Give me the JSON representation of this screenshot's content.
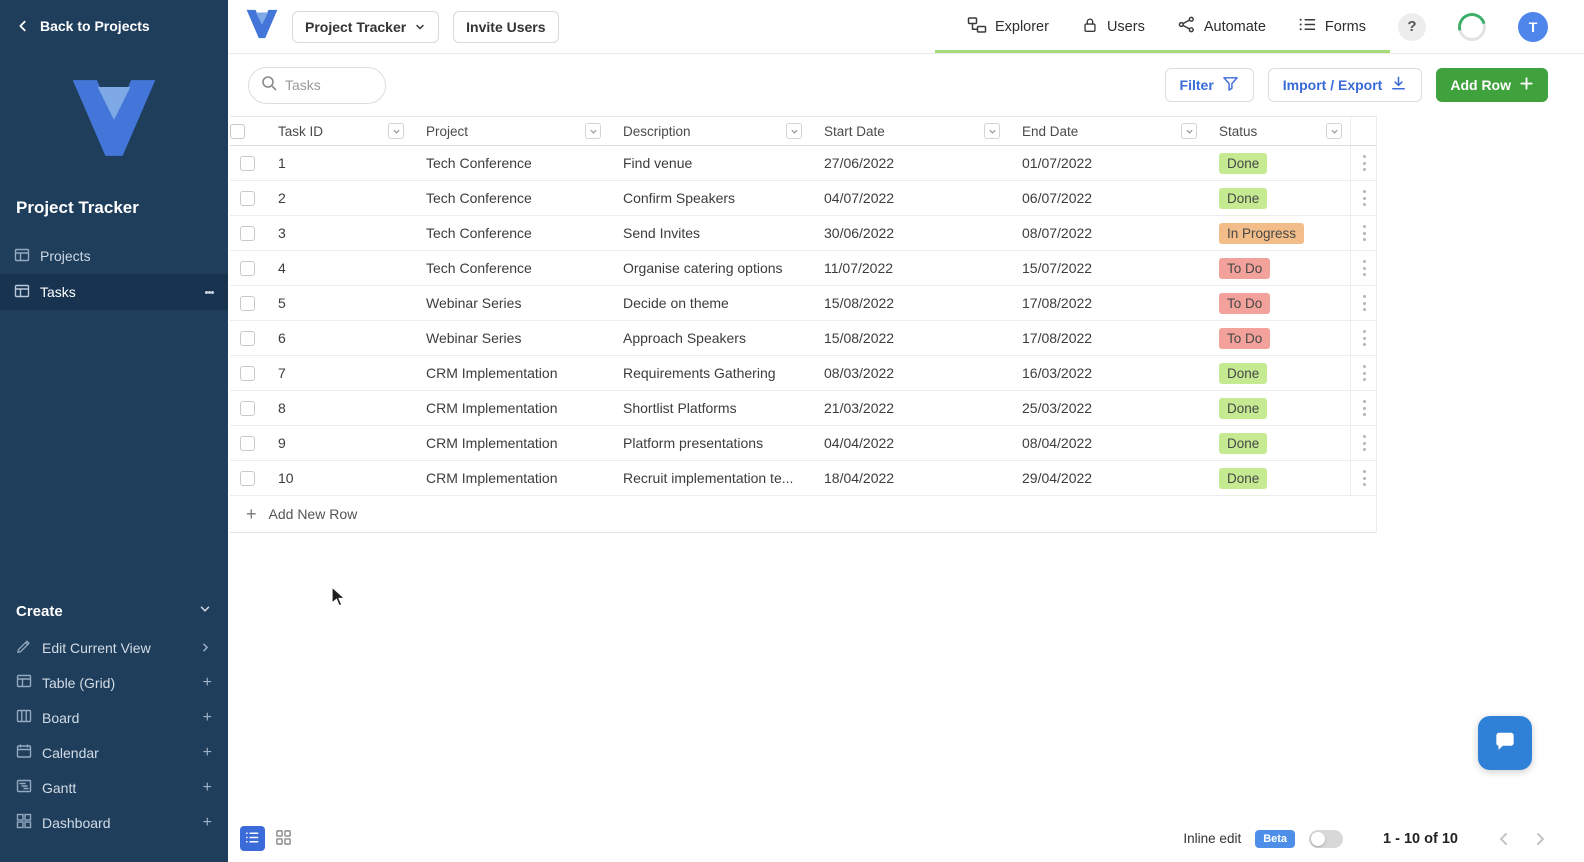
{
  "colors": {
    "sidebar_bg": "#1f3e5c",
    "sidebar_selected_bg": "#173350",
    "accent_blue": "#3a6bd8",
    "add_row_green": "#3fa23d",
    "status_done_bg": "#c6ea91",
    "status_in_progress_bg": "#f2bd88",
    "status_todo_bg": "#f2a29a",
    "status_text": "#474747",
    "beta_badge_bg": "#4d8fe8",
    "nav_underline_green": "#a6d977",
    "avatar_bg": "#4f86ec",
    "chat_button_bg": "#2f80d7",
    "logo_blue": "#4376d8",
    "logo_light_blue": "#7fa9e6"
  },
  "sidebar": {
    "back_label": "Back to Projects",
    "workspace_title": "Project Tracker",
    "items": [
      {
        "label": "Projects",
        "selected": false
      },
      {
        "label": "Tasks",
        "selected": true
      }
    ],
    "create_label": "Create",
    "create_items": [
      {
        "label": "Edit Current View"
      },
      {
        "label": "Table (Grid)"
      },
      {
        "label": "Board"
      },
      {
        "label": "Calendar"
      },
      {
        "label": "Gantt"
      },
      {
        "label": "Dashboard"
      }
    ]
  },
  "header": {
    "workspace_selector_label": "Project Tracker",
    "invite_button_label": "Invite Users",
    "nav_items": [
      {
        "label": "Explorer"
      },
      {
        "label": "Users"
      },
      {
        "label": "Automate"
      },
      {
        "label": "Forms"
      }
    ],
    "help_label": "?",
    "avatar_initial": "T"
  },
  "toolbar": {
    "search_placeholder": "Tasks",
    "filter_label": "Filter",
    "import_export_label": "Import / Export",
    "add_row_label": "Add Row"
  },
  "table": {
    "columns": [
      "Task ID",
      "Project",
      "Description",
      "Start Date",
      "End Date",
      "Status"
    ],
    "rows": [
      {
        "task_id": "1",
        "project": "Tech Conference",
        "description": "Find venue",
        "start_date": "27/06/2022",
        "end_date": "01/07/2022",
        "status": "Done"
      },
      {
        "task_id": "2",
        "project": "Tech Conference",
        "description": "Confirm Speakers",
        "start_date": "04/07/2022",
        "end_date": "06/07/2022",
        "status": "Done"
      },
      {
        "task_id": "3",
        "project": "Tech Conference",
        "description": "Send Invites",
        "start_date": "30/06/2022",
        "end_date": "08/07/2022",
        "status": "In Progress"
      },
      {
        "task_id": "4",
        "project": "Tech Conference",
        "description": "Organise catering options",
        "start_date": "11/07/2022",
        "end_date": "15/07/2022",
        "status": "To Do"
      },
      {
        "task_id": "5",
        "project": "Webinar Series",
        "description": "Decide on theme",
        "start_date": "15/08/2022",
        "end_date": "17/08/2022",
        "status": "To Do"
      },
      {
        "task_id": "6",
        "project": "Webinar Series",
        "description": "Approach Speakers",
        "start_date": "15/08/2022",
        "end_date": "17/08/2022",
        "status": "To Do"
      },
      {
        "task_id": "7",
        "project": "CRM Implementation",
        "description": "Requirements Gathering",
        "start_date": "08/03/2022",
        "end_date": "16/03/2022",
        "status": "Done"
      },
      {
        "task_id": "8",
        "project": "CRM Implementation",
        "description": "Shortlist Platforms",
        "start_date": "21/03/2022",
        "end_date": "25/03/2022",
        "status": "Done"
      },
      {
        "task_id": "9",
        "project": "CRM Implementation",
        "description": "Platform presentations",
        "start_date": "04/04/2022",
        "end_date": "08/04/2022",
        "status": "Done"
      },
      {
        "task_id": "10",
        "project": "CRM Implementation",
        "description": "Recruit implementation te...",
        "start_date": "18/04/2022",
        "end_date": "29/04/2022",
        "status": "Done"
      }
    ],
    "add_new_row_label": "Add New Row"
  },
  "footer": {
    "inline_edit_label": "Inline edit",
    "beta_label": "Beta",
    "range_label": "1 - 10 of 10"
  }
}
